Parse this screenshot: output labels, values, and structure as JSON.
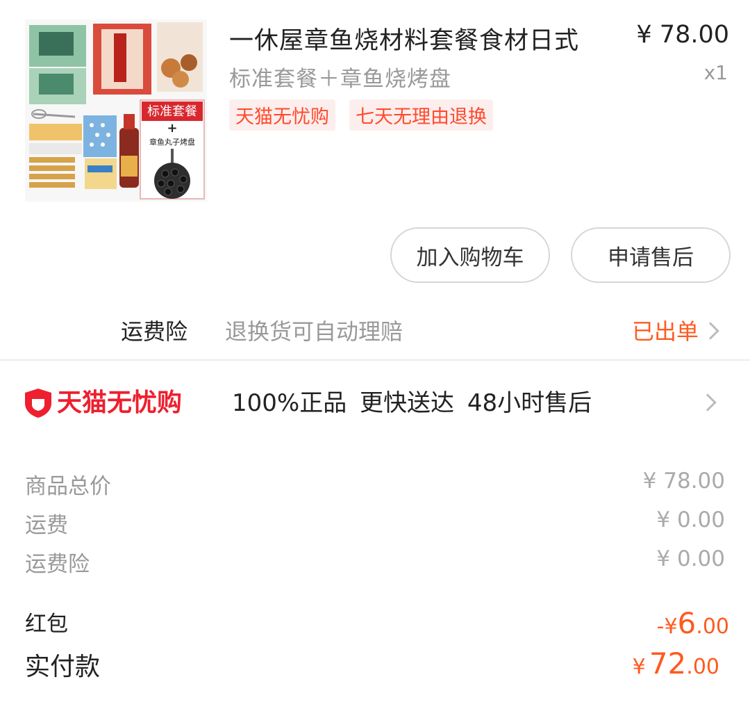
{
  "product": {
    "title": "一休屋章鱼烧材料套餐食材日式",
    "price": "¥ 78.00",
    "sku": "标准套餐＋章鱼烧烤盘",
    "quantity": "x1",
    "tags": [
      "天猫无忧购",
      "七天无理由退换"
    ],
    "image": {
      "banner_text": "标准套餐",
      "plus_text": "+",
      "caption_text": "章鱼丸子烤盘"
    }
  },
  "buttons": {
    "add_to_cart": "加入购物车",
    "after_sales": "申请售后"
  },
  "insurance": {
    "label": "运费险",
    "description": "退换货可自动理赔",
    "status": "已出单"
  },
  "guarantee": {
    "brand": "天猫无忧购",
    "text": "100%正品 更快送达 48小时售后"
  },
  "summary": {
    "rows": [
      {
        "label": "商品总价",
        "value": "¥ 78.00"
      },
      {
        "label": "运费",
        "value": "¥ 0.00"
      },
      {
        "label": "运费险",
        "value": "¥ 0.00"
      }
    ],
    "red_packet": {
      "label": "红包",
      "prefix": "-¥",
      "int": "6",
      "dec": ".00"
    },
    "paid": {
      "label": "实付款",
      "prefix": "¥",
      "int": "72",
      "dec": ".00"
    }
  },
  "colors": {
    "accent": "#ff5a1f",
    "brand_red": "#ee1f2e",
    "tag_bg": "#fdeeee",
    "muted": "#999999"
  }
}
